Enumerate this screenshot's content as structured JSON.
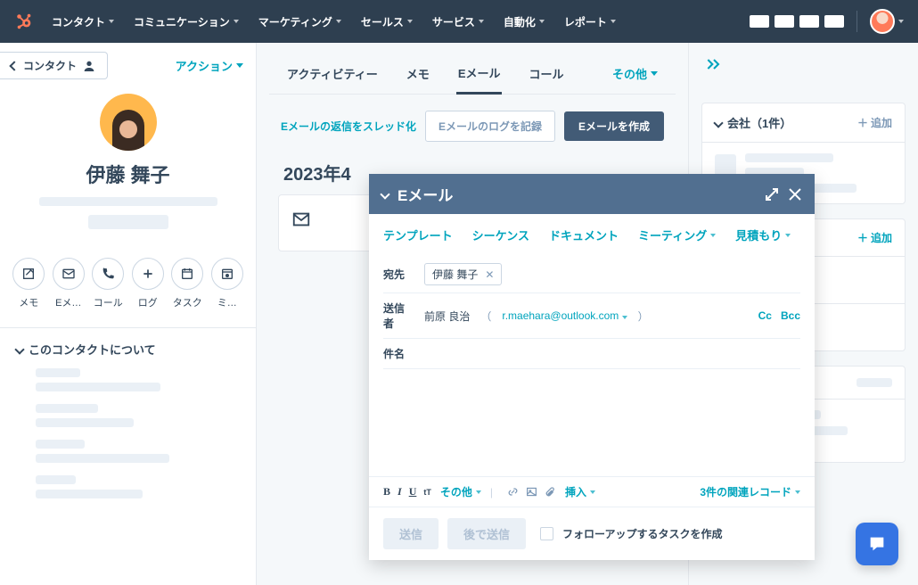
{
  "nav": {
    "items": [
      "コンタクト",
      "コミュニケーション",
      "マーケティング",
      "セールス",
      "サービス",
      "自動化",
      "レポート"
    ]
  },
  "left": {
    "back_label": "コンタクト",
    "action_label": "アクション",
    "contact_name": "伊藤 舞子",
    "icons": [
      {
        "name": "note",
        "label": "メモ"
      },
      {
        "name": "email",
        "label": "Eメ…"
      },
      {
        "name": "call",
        "label": "コール"
      },
      {
        "name": "log",
        "label": "ログ"
      },
      {
        "name": "task",
        "label": "タスク"
      },
      {
        "name": "meeting",
        "label": "ミ…"
      }
    ],
    "about_title": "このコンタクトについて"
  },
  "tabs": {
    "items": [
      "アクティビティー",
      "メモ",
      "Eメール",
      "コール"
    ],
    "active_index": 2,
    "other_label": "その他"
  },
  "toolbar": {
    "thread_label": "Eメールの返信をスレッド化",
    "log_label": "Eメールのログを記録",
    "compose_label": "Eメールを作成"
  },
  "timeline": {
    "date_heading": "2023年4"
  },
  "right": {
    "cards": [
      {
        "title": "会社（1件）",
        "add_label": "追加",
        "add_style": "gray"
      },
      {
        "title": "",
        "add_label": "追加",
        "add_style": "teal"
      },
      {
        "title": "",
        "add_label": "",
        "add_style": ""
      }
    ]
  },
  "compose": {
    "title": "Eメール",
    "menus": {
      "template": "テンプレート",
      "sequence": "シーケンス",
      "document": "ドキュメント",
      "meeting": "ミーティング",
      "quote": "見積もり"
    },
    "to_label": "宛先",
    "to_chip": "伊藤 舞子",
    "from_label": "送信者",
    "from_name": "前原 良治",
    "from_email": "r.maehara@outlook.com",
    "cc_label": "Cc",
    "bcc_label": "Bcc",
    "subject_label": "件名",
    "toolbar": {
      "other_label": "その他",
      "insert_label": "挿入",
      "related_label": "3件の関連レコード"
    },
    "actions": {
      "send": "送信",
      "send_later": "後で送信",
      "followup": "フォローアップするタスクを作成"
    }
  }
}
